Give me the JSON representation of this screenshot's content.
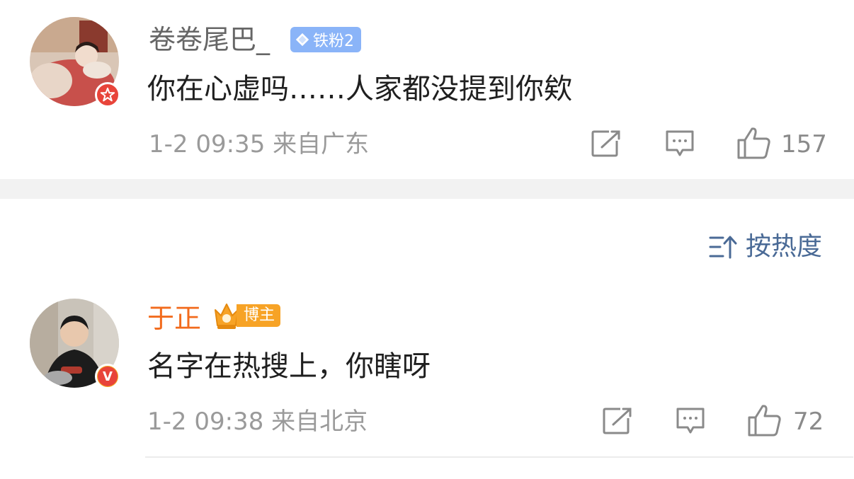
{
  "comments": [
    {
      "username": "卷卷尾巴_",
      "badge": "铁粉2",
      "text": "你在心虚吗……人家都没提到你欸",
      "meta": "1-2 09:35 来自广东",
      "likes": "157",
      "name_color": "#666666"
    },
    {
      "username": "于正",
      "badge": "博主",
      "text": "名字在热搜上，你瞎呀",
      "meta": "1-2 09:38 来自北京",
      "likes": "72",
      "name_color": "#f26b1d"
    }
  ],
  "sort": {
    "label": "按热度"
  },
  "icons": {
    "share": "share-icon",
    "comment": "comment-icon",
    "like": "thumbs-up-icon",
    "sort": "sort-icon"
  },
  "colors": {
    "accent_blue": "#4a6a96",
    "badge_orange": "#f7a326",
    "verified_red": "#e8443a",
    "verified_gold": "#f5a623"
  }
}
